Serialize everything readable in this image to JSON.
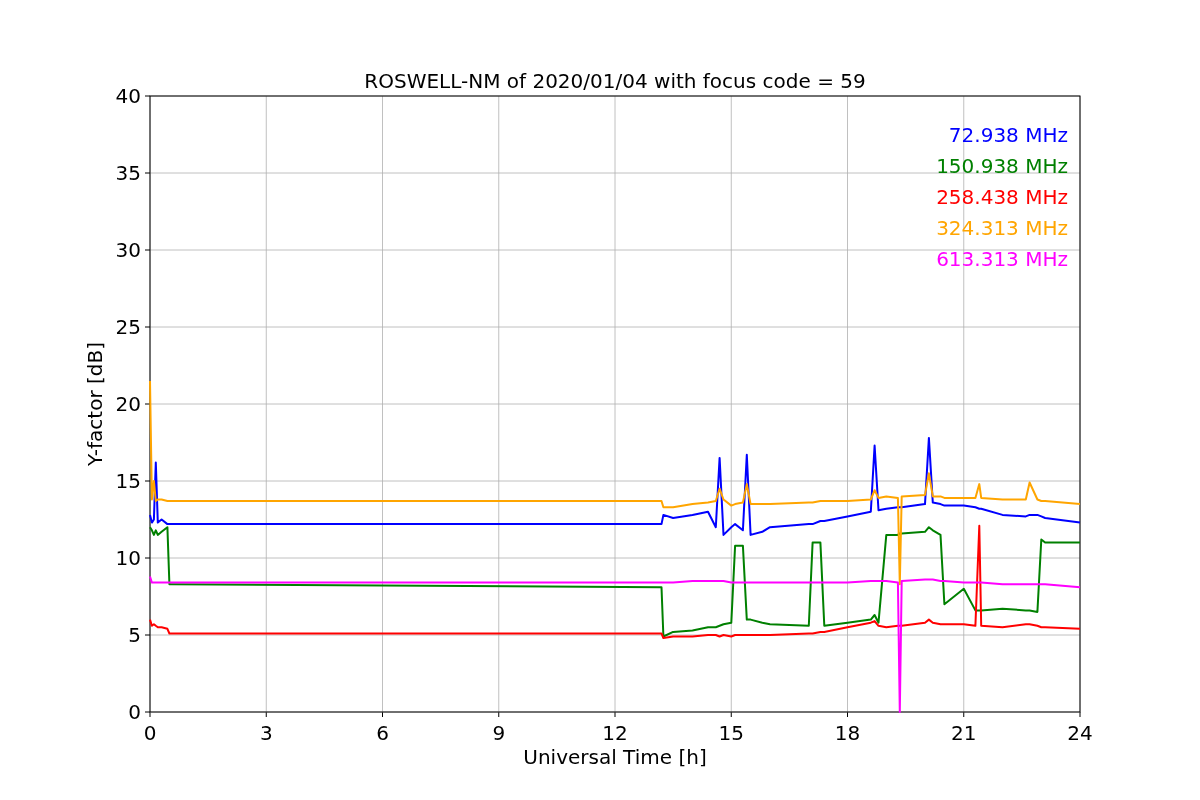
{
  "chart_data": {
    "type": "line",
    "title": "ROSWELL-NM of 2020/01/04 with focus code = 59",
    "xlabel": "Universal Time [h]",
    "ylabel": "Y-factor [dB]",
    "x": [
      0,
      0.05,
      0.1,
      0.15,
      0.2,
      0.3,
      0.45,
      0.5,
      0.55,
      13.2,
      13.25,
      13.5,
      14,
      14.4,
      14.6,
      14.7,
      14.8,
      15,
      15.1,
      15.3,
      15.4,
      15.5,
      15.8,
      16,
      17,
      17.1,
      17.3,
      17.4,
      18,
      18.6,
      18.7,
      18.8,
      19,
      19.3,
      19.35,
      19.4,
      20,
      20.1,
      20.2,
      20.4,
      20.5,
      21,
      21.3,
      21.4,
      21.45,
      22,
      22.6,
      22.7,
      22.9,
      23,
      23.1,
      24
    ],
    "series": [
      {
        "name": "72.938 MHz",
        "color": "#0000ff",
        "values": [
          12.8,
          12.3,
          12.5,
          16.2,
          12.3,
          12.5,
          12.2,
          12.2,
          12.2,
          12.2,
          12.8,
          12.6,
          12.8,
          13,
          12,
          16.5,
          11.5,
          12,
          12.2,
          11.8,
          16.7,
          11.5,
          11.7,
          12,
          12.2,
          12.2,
          12.4,
          12.4,
          12.7,
          13,
          17.3,
          13.1,
          13.2,
          13.3,
          13.3,
          13.3,
          13.5,
          17.8,
          13.6,
          13.5,
          13.4,
          13.4,
          13.3,
          13.2,
          13.2,
          12.8,
          12.7,
          12.8,
          12.8,
          12.7,
          12.6,
          12.3
        ]
      },
      {
        "name": "150.938 MHz",
        "color": "#008000",
        "values": [
          12,
          11.8,
          11.5,
          11.8,
          11.5,
          11.7,
          12,
          8.3,
          8.3,
          8.1,
          4.9,
          5.2,
          5.3,
          5.5,
          5.5,
          5.6,
          5.7,
          5.8,
          10.8,
          10.8,
          6,
          6,
          5.8,
          5.7,
          5.6,
          11,
          11,
          5.6,
          5.8,
          6,
          6.3,
          5.8,
          11.5,
          11.5,
          11.6,
          11.6,
          11.7,
          12,
          11.8,
          11.5,
          7,
          8,
          6.6,
          6.6,
          6.6,
          6.7,
          6.6,
          6.6,
          6.5,
          11.2,
          11,
          11
        ]
      },
      {
        "name": "258.438 MHz",
        "color": "#ff0000",
        "values": [
          6,
          5.6,
          5.7,
          5.6,
          5.5,
          5.5,
          5.4,
          5.1,
          5.1,
          5.1,
          4.8,
          4.9,
          4.9,
          5,
          5,
          4.9,
          5,
          4.9,
          5,
          5,
          5,
          5,
          5,
          5,
          5.1,
          5.1,
          5.2,
          5.2,
          5.5,
          5.8,
          5.9,
          5.6,
          5.5,
          5.6,
          5.6,
          5.6,
          5.8,
          6,
          5.8,
          5.7,
          5.7,
          5.7,
          5.6,
          12.1,
          5.6,
          5.5,
          5.7,
          5.7,
          5.6,
          5.5,
          5.5,
          5.4
        ]
      },
      {
        "name": "324.313 MHz",
        "color": "#ffa500",
        "values": [
          21.5,
          13.8,
          15,
          13.7,
          13.8,
          13.8,
          13.7,
          13.7,
          13.7,
          13.7,
          13.3,
          13.3,
          13.5,
          13.6,
          13.7,
          14.5,
          13.8,
          13.4,
          13.5,
          13.6,
          14.8,
          13.5,
          13.5,
          13.5,
          13.6,
          13.6,
          13.7,
          13.7,
          13.7,
          13.8,
          14.4,
          13.9,
          14,
          13.9,
          8.3,
          14,
          14.1,
          15.5,
          14,
          14,
          13.9,
          13.9,
          13.9,
          14.8,
          13.9,
          13.8,
          13.8,
          14.9,
          13.8,
          13.7,
          13.7,
          13.5
        ]
      },
      {
        "name": "613.313 MHz",
        "color": "#ff00ff",
        "values": [
          8.8,
          8.4,
          8.4,
          8.4,
          8.4,
          8.4,
          8.4,
          8.4,
          8.4,
          8.4,
          8.4,
          8.4,
          8.5,
          8.5,
          8.5,
          8.5,
          8.5,
          8.4,
          8.4,
          8.4,
          8.4,
          8.4,
          8.4,
          8.4,
          8.4,
          8.4,
          8.4,
          8.4,
          8.4,
          8.5,
          8.5,
          8.5,
          8.5,
          8.4,
          0,
          8.5,
          8.6,
          8.6,
          8.6,
          8.5,
          8.5,
          8.4,
          8.4,
          8.4,
          8.4,
          8.3,
          8.3,
          8.3,
          8.3,
          8.3,
          8.3,
          8.1
        ]
      }
    ],
    "grid": true,
    "xlim": [
      0,
      24
    ],
    "ylim": [
      0,
      40
    ],
    "xticks": [
      0,
      3,
      6,
      9,
      12,
      15,
      18,
      21,
      24
    ],
    "yticks": [
      0,
      5,
      10,
      15,
      20,
      25,
      30,
      35,
      40
    ]
  }
}
